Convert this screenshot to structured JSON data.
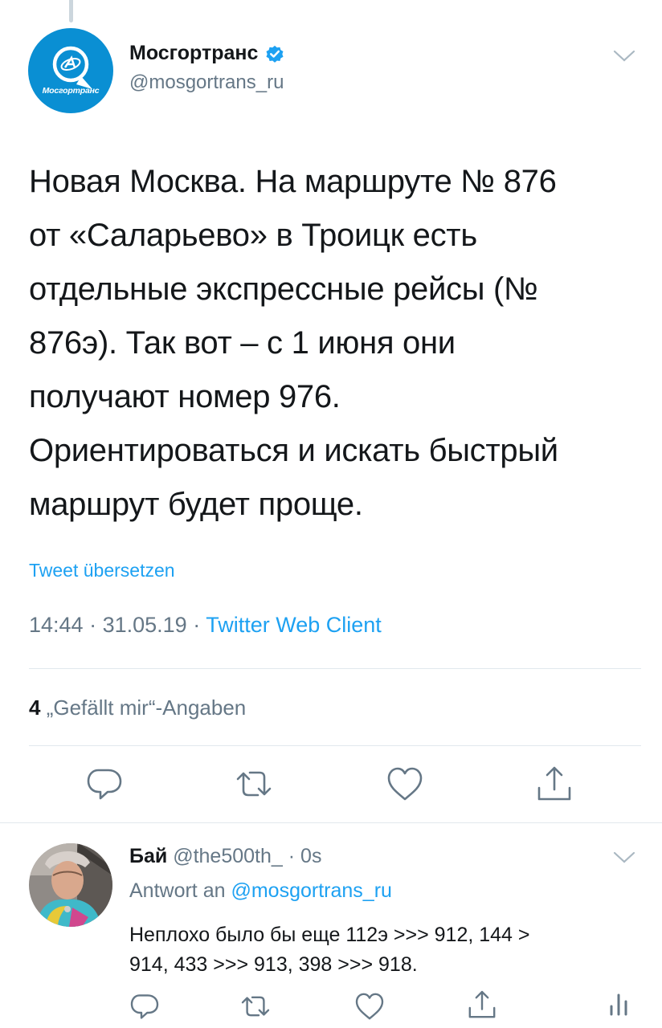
{
  "tweet": {
    "avatar_text": "Мосгортранс",
    "display_name": "Мосгортранс",
    "handle": "@mosgortrans_ru",
    "text_lines": [
      "Новая Москва. На маршруте № 876",
      "от «Саларьево» в Троицк есть",
      "отдельные экспрессные рейсы (№",
      "876э). Так вот – с 1 июня они",
      "получают номер 976.",
      "Ориентироваться и искать быстрый",
      "маршрут будет проще."
    ],
    "translate_label": "Tweet übersetzen",
    "time": "14:44",
    "date": "31.05.19",
    "client": "Twitter Web Client",
    "likes_count": "4",
    "likes_label": "„Gefällt mir“-Angaben",
    "icons": [
      "reply-icon",
      "retweet-icon",
      "like-icon",
      "share-icon",
      "verified-badge-icon",
      "chevron-down-icon"
    ]
  },
  "reply": {
    "display_name": "Бай",
    "handle": "@the500th_",
    "time_ago": "0s",
    "replying_prefix": "Antwort an",
    "replying_to": "@mosgortrans_ru",
    "text_lines": [
      "Неплохо было бы еще 112э >>> 912, 144 >",
      "914, 433 >>> 913, 398 >>> 918."
    ],
    "icons": [
      "reply-icon",
      "retweet-icon",
      "like-icon",
      "share-icon",
      "analytics-icon",
      "chevron-down-icon"
    ]
  },
  "colors": {
    "accent": "#1da1f2",
    "muted": "#657786",
    "text": "#14171a",
    "divider": "#e1e8ed",
    "brand": "#0a8fd3"
  }
}
